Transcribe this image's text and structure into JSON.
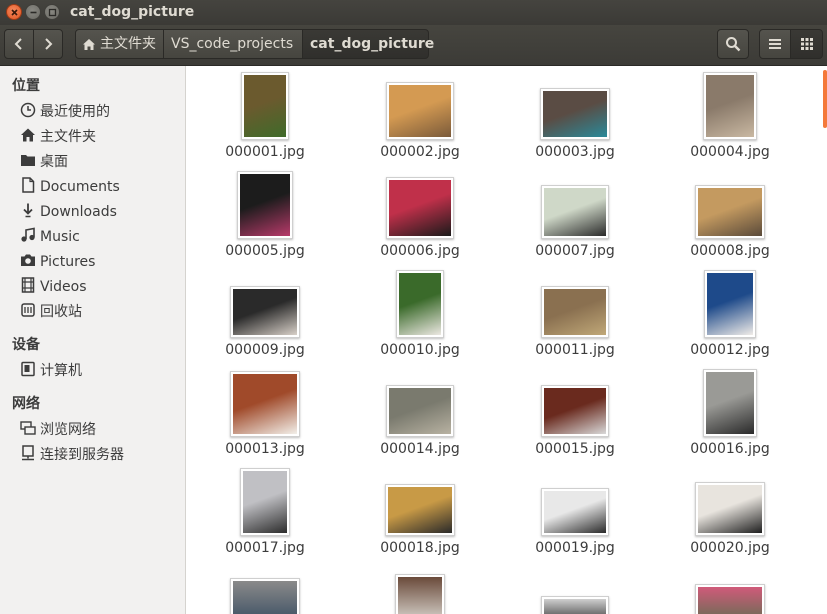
{
  "window": {
    "title": "cat_dog_picture"
  },
  "toolbar": {
    "breadcrumbs": [
      "主文件夹",
      "VS_code_projects",
      "cat_dog_picture"
    ]
  },
  "sidebar": {
    "sections": [
      {
        "title": "位置",
        "items": [
          {
            "label": "最近使用的",
            "icon": "clock-icon"
          },
          {
            "label": "主文件夹",
            "icon": "home-icon"
          },
          {
            "label": "桌面",
            "icon": "folder-icon"
          },
          {
            "label": "Documents",
            "icon": "document-icon"
          },
          {
            "label": "Downloads",
            "icon": "download-icon"
          },
          {
            "label": "Music",
            "icon": "music-icon"
          },
          {
            "label": "Pictures",
            "icon": "camera-icon"
          },
          {
            "label": "Videos",
            "icon": "film-icon"
          },
          {
            "label": "回收站",
            "icon": "trash-icon"
          }
        ]
      },
      {
        "title": "设备",
        "items": [
          {
            "label": "计算机",
            "icon": "drive-icon"
          }
        ]
      },
      {
        "title": "网络",
        "items": [
          {
            "label": "浏览网络",
            "icon": "network-icon"
          },
          {
            "label": "连接到服务器",
            "icon": "server-icon"
          }
        ]
      }
    ]
  },
  "files": [
    "000001.jpg",
    "000002.jpg",
    "000003.jpg",
    "000004.jpg",
    "000005.jpg",
    "000006.jpg",
    "000007.jpg",
    "000008.jpg",
    "000009.jpg",
    "000010.jpg",
    "000011.jpg",
    "000012.jpg",
    "000013.jpg",
    "000014.jpg",
    "000015.jpg",
    "000016.jpg",
    "000017.jpg",
    "000018.jpg",
    "000019.jpg",
    "000020.jpg"
  ],
  "colors": {
    "accent": "#f4793a",
    "titlebar": "#3c3b37",
    "sidebar": "#f2f1f0"
  }
}
